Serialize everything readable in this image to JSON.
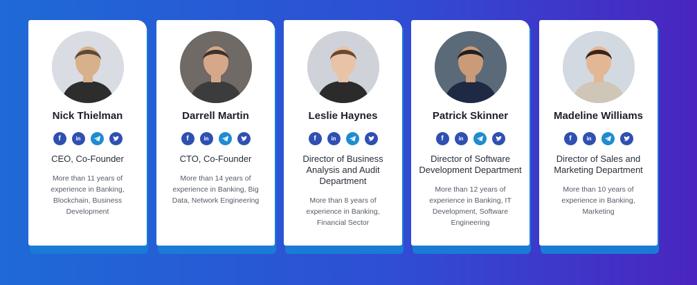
{
  "team": [
    {
      "name": "Nick Thielman",
      "role": "CEO, Co-Founder",
      "description": "More than 11 years of experience in Banking, Blockchain, Business Development",
      "avatar": {
        "bg": "#d9dde3",
        "skin": "#d9b08c",
        "hair": "#5a4a3a",
        "shirt": "#2d2d2d"
      }
    },
    {
      "name": "Darrell Martin",
      "role": "CTO, Co-Founder",
      "description": "More than 14 years of experience in Banking, Big Data, Network Engineering",
      "avatar": {
        "bg": "#6f6a66",
        "skin": "#d6a889",
        "hair": "#3b3230",
        "shirt": "#3c3c3c"
      }
    },
    {
      "name": "Leslie Haynes",
      "role": "Director of Business Analysis and Audit Department",
      "description": "More than 8 years of experience in Banking, Financial Sector",
      "avatar": {
        "bg": "#cfd3d9",
        "skin": "#e8c3a6",
        "hair": "#6b4630",
        "shirt": "#2b2b2b"
      }
    },
    {
      "name": "Patrick Skinner",
      "role": "Director of Software Development Department",
      "description": "More than 12 years of experience in Banking, IT Development, Software Engineering",
      "avatar": {
        "bg": "#5b6a78",
        "skin": "#c99b78",
        "hair": "#1f1f22",
        "shirt": "#1e2a44"
      }
    },
    {
      "name": "Madeline Williams",
      "role": "Director of Sales and Marketing Department",
      "description": "More than 10 years of experience in Banking, Marketing",
      "avatar": {
        "bg": "#d3d9e0",
        "skin": "#e3b796",
        "hair": "#3a2418",
        "shirt": "#cfc6b8"
      }
    }
  ],
  "social_icons": [
    "facebook-icon",
    "linkedin-icon",
    "telegram-icon",
    "twitter-icon"
  ],
  "colors": {
    "accent": "#2f4fb2",
    "telegram": "#1f8ccf",
    "card_shadow": "#1a7bd6"
  }
}
